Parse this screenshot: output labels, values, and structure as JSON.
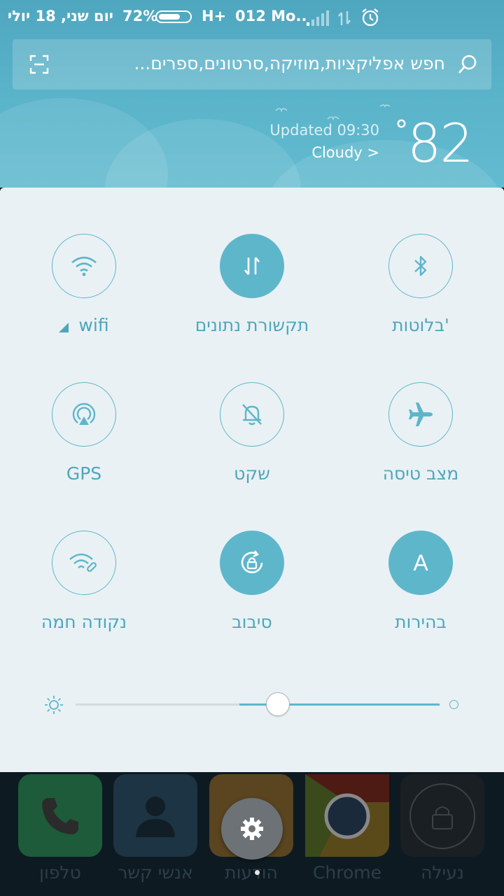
{
  "status_bar": {
    "date": "יום שני, 18 יולי",
    "battery_percent_text": "72%",
    "battery_level": 0.72,
    "network_type": "H+",
    "carrier": "012 Mo.."
  },
  "search": {
    "placeholder": "חפש אפליקציות,מוזיקה,סרטונים,ספרים..."
  },
  "weather": {
    "updated": "Updated 09:30",
    "condition": "Cloudy >",
    "temperature": "82",
    "degree_symbol": "°"
  },
  "tiles": [
    {
      "label": "wifi",
      "icon": "wifi-icon",
      "active": false
    },
    {
      "label": "תקשורת נתונים",
      "icon": "data-transfer-icon",
      "active": true
    },
    {
      "label": "בלוטות'",
      "icon": "bluetooth-icon",
      "active": false
    },
    {
      "label": "GPS",
      "icon": "gps-icon",
      "active": false
    },
    {
      "label": "שקט",
      "icon": "bell-muted-icon",
      "active": false
    },
    {
      "label": "מצב טיסה",
      "icon": "airplane-icon",
      "active": false
    },
    {
      "label": "נקודה חמה",
      "icon": "hotspot-icon",
      "active": false
    },
    {
      "label": "סיבוב",
      "icon": "rotation-lock-icon",
      "active": true
    },
    {
      "label": "בהירות",
      "icon": "auto-brightness-icon",
      "active": true,
      "glyph": "A"
    }
  ],
  "brightness": {
    "level_fraction": 0.55
  },
  "dock": [
    {
      "label": "טלפון",
      "icon": "phone-icon",
      "color": "#1d5b3a"
    },
    {
      "label": "אנשי קשר",
      "icon": "contacts-icon",
      "color": "#1c3443"
    },
    {
      "label": "הודעות",
      "icon": "messages-icon",
      "color": "#5a4520"
    },
    {
      "label": "Chrome",
      "icon": "chrome-icon",
      "color": "#5a4a1a"
    },
    {
      "label": "נעילה",
      "icon": "lock-icon",
      "color": "#1a1f23"
    }
  ],
  "colors": {
    "accent": "#5eb6cb",
    "header": "#5ab4ca",
    "panel": "#e9f1f4"
  }
}
